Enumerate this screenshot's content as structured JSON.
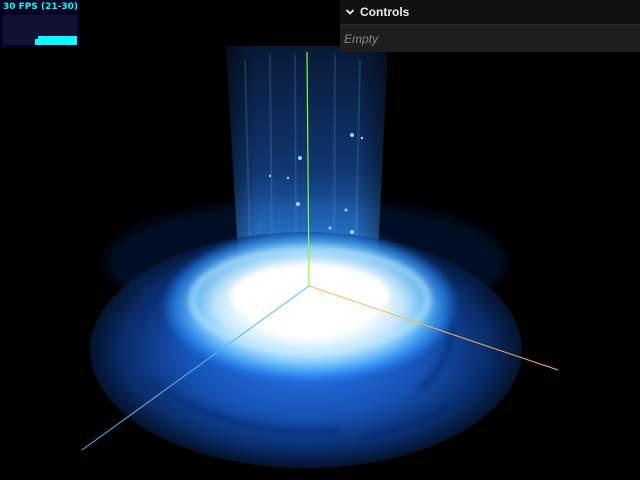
{
  "stats": {
    "fps_label": "30 FPS (21-30)"
  },
  "controls": {
    "title": "Controls",
    "empty_label": "Empty"
  },
  "colors": {
    "glow": "#3a9bff",
    "core": "#ffffff",
    "axis_x": "#ffb84d",
    "axis_y": "#7fff3a",
    "axis_z": "#4fb8ff",
    "stats_text": "#00ffff"
  }
}
